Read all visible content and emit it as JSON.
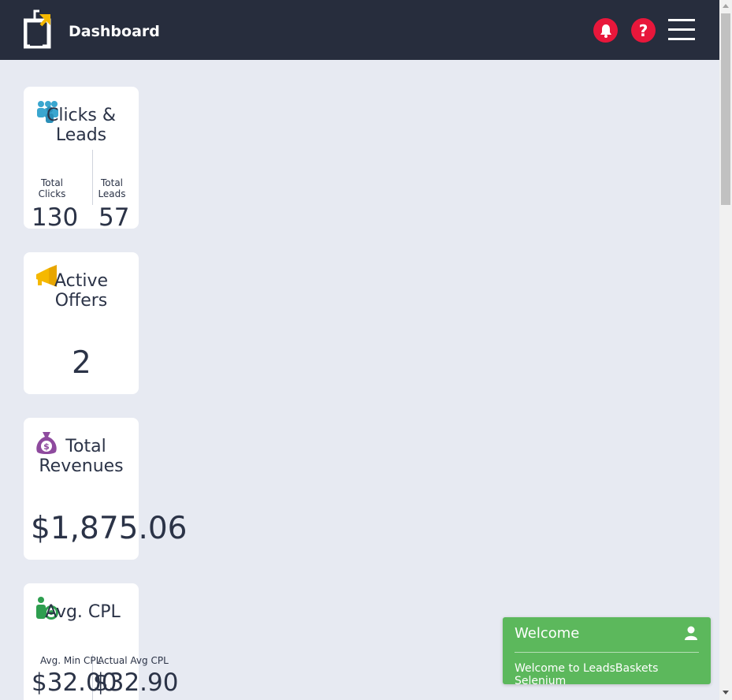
{
  "header": {
    "title": "Dashboard",
    "help_label": "?",
    "accent_color": "#e8173b",
    "bar_color": "#272d3d"
  },
  "cards": {
    "clicks_leads": {
      "title_line1": "Clicks &",
      "title_line2": "Leads",
      "icon": "users-group-icon",
      "left_label_line1": "Total",
      "left_label_line2": "Clicks",
      "left_value": "130",
      "right_label_line1": "Total",
      "right_label_line2": "Leads",
      "right_value": "57"
    },
    "active_offers": {
      "title_line1": "Active",
      "title_line2": "Offers",
      "icon": "megaphone-icon",
      "value": "2"
    },
    "total_revenues": {
      "title_line1": "Total",
      "title_line2": "Revenues",
      "icon": "money-bag-icon",
      "value": "$1,875.06"
    },
    "avg_cpl": {
      "title": "Avg. CPL",
      "icon": "user-dollar-icon",
      "left_label": "Avg. Min CPL",
      "left_value": "$32.00",
      "right_label": "Actual Avg CPL",
      "right_value": "$32.90"
    }
  },
  "toast": {
    "title": "Welcome",
    "message": "Welcome to LeadsBaskets Selenium",
    "icon": "user-icon",
    "color": "#5cb85c"
  }
}
